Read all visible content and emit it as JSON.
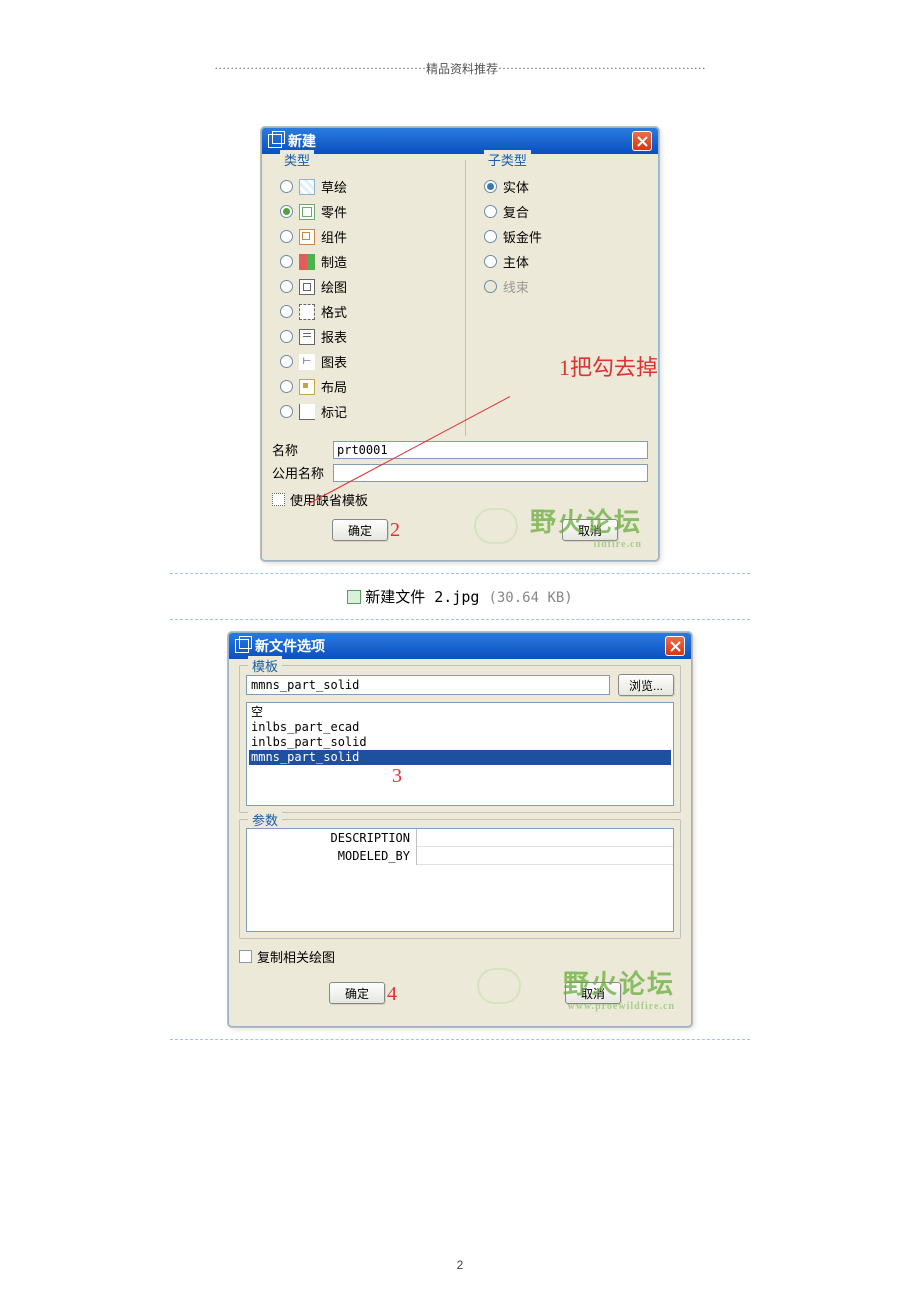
{
  "header": {
    "dots": "·····················································",
    "text": "精品资料推荐",
    "dots2": "····················································"
  },
  "dialog1": {
    "title": "新建",
    "type_legend": "类型",
    "subtype_legend": "子类型",
    "types": {
      "sketch": "草绘",
      "part": "零件",
      "assembly": "组件",
      "manufacturing": "制造",
      "drawing": "绘图",
      "format": "格式",
      "report": "报表",
      "diagram": "图表",
      "layout": "布局",
      "markup": "标记"
    },
    "subtypes": {
      "solid": "实体",
      "composite": "复合",
      "sheetmetal": "钣金件",
      "body": "主体",
      "harness": "线束"
    },
    "annotation1": "1把勾去掉",
    "name_label": "名称",
    "name_value": "prt0001",
    "common_name_label": "公用名称",
    "use_default_template": "使用缺省模板",
    "ok": "确定",
    "ok_num": "2",
    "cancel": "取消",
    "watermark": "野火论坛",
    "watermark_sub": "ildfire.cn"
  },
  "caption1": {
    "filename": "新建文件 2.jpg",
    "size": "(30.64 KB)"
  },
  "dialog2": {
    "title": "新文件选项",
    "template_legend": "模板",
    "template_value": "mmns_part_solid",
    "browse": "浏览...",
    "list": {
      "empty": "空",
      "i1": "inlbs_part_ecad",
      "i2": "inlbs_part_solid",
      "i3": "mmns_part_solid"
    },
    "sel_num": "3",
    "params_legend": "参数",
    "param_desc": "DESCRIPTION",
    "param_modeled": "MODELED_BY",
    "copy_drawings": "复制相关绘图",
    "ok": "确定",
    "ok_num": "4",
    "cancel": "取消",
    "watermark": "野火论坛",
    "watermark_sub": "www.proewildfire.cn"
  },
  "page_number": "2"
}
